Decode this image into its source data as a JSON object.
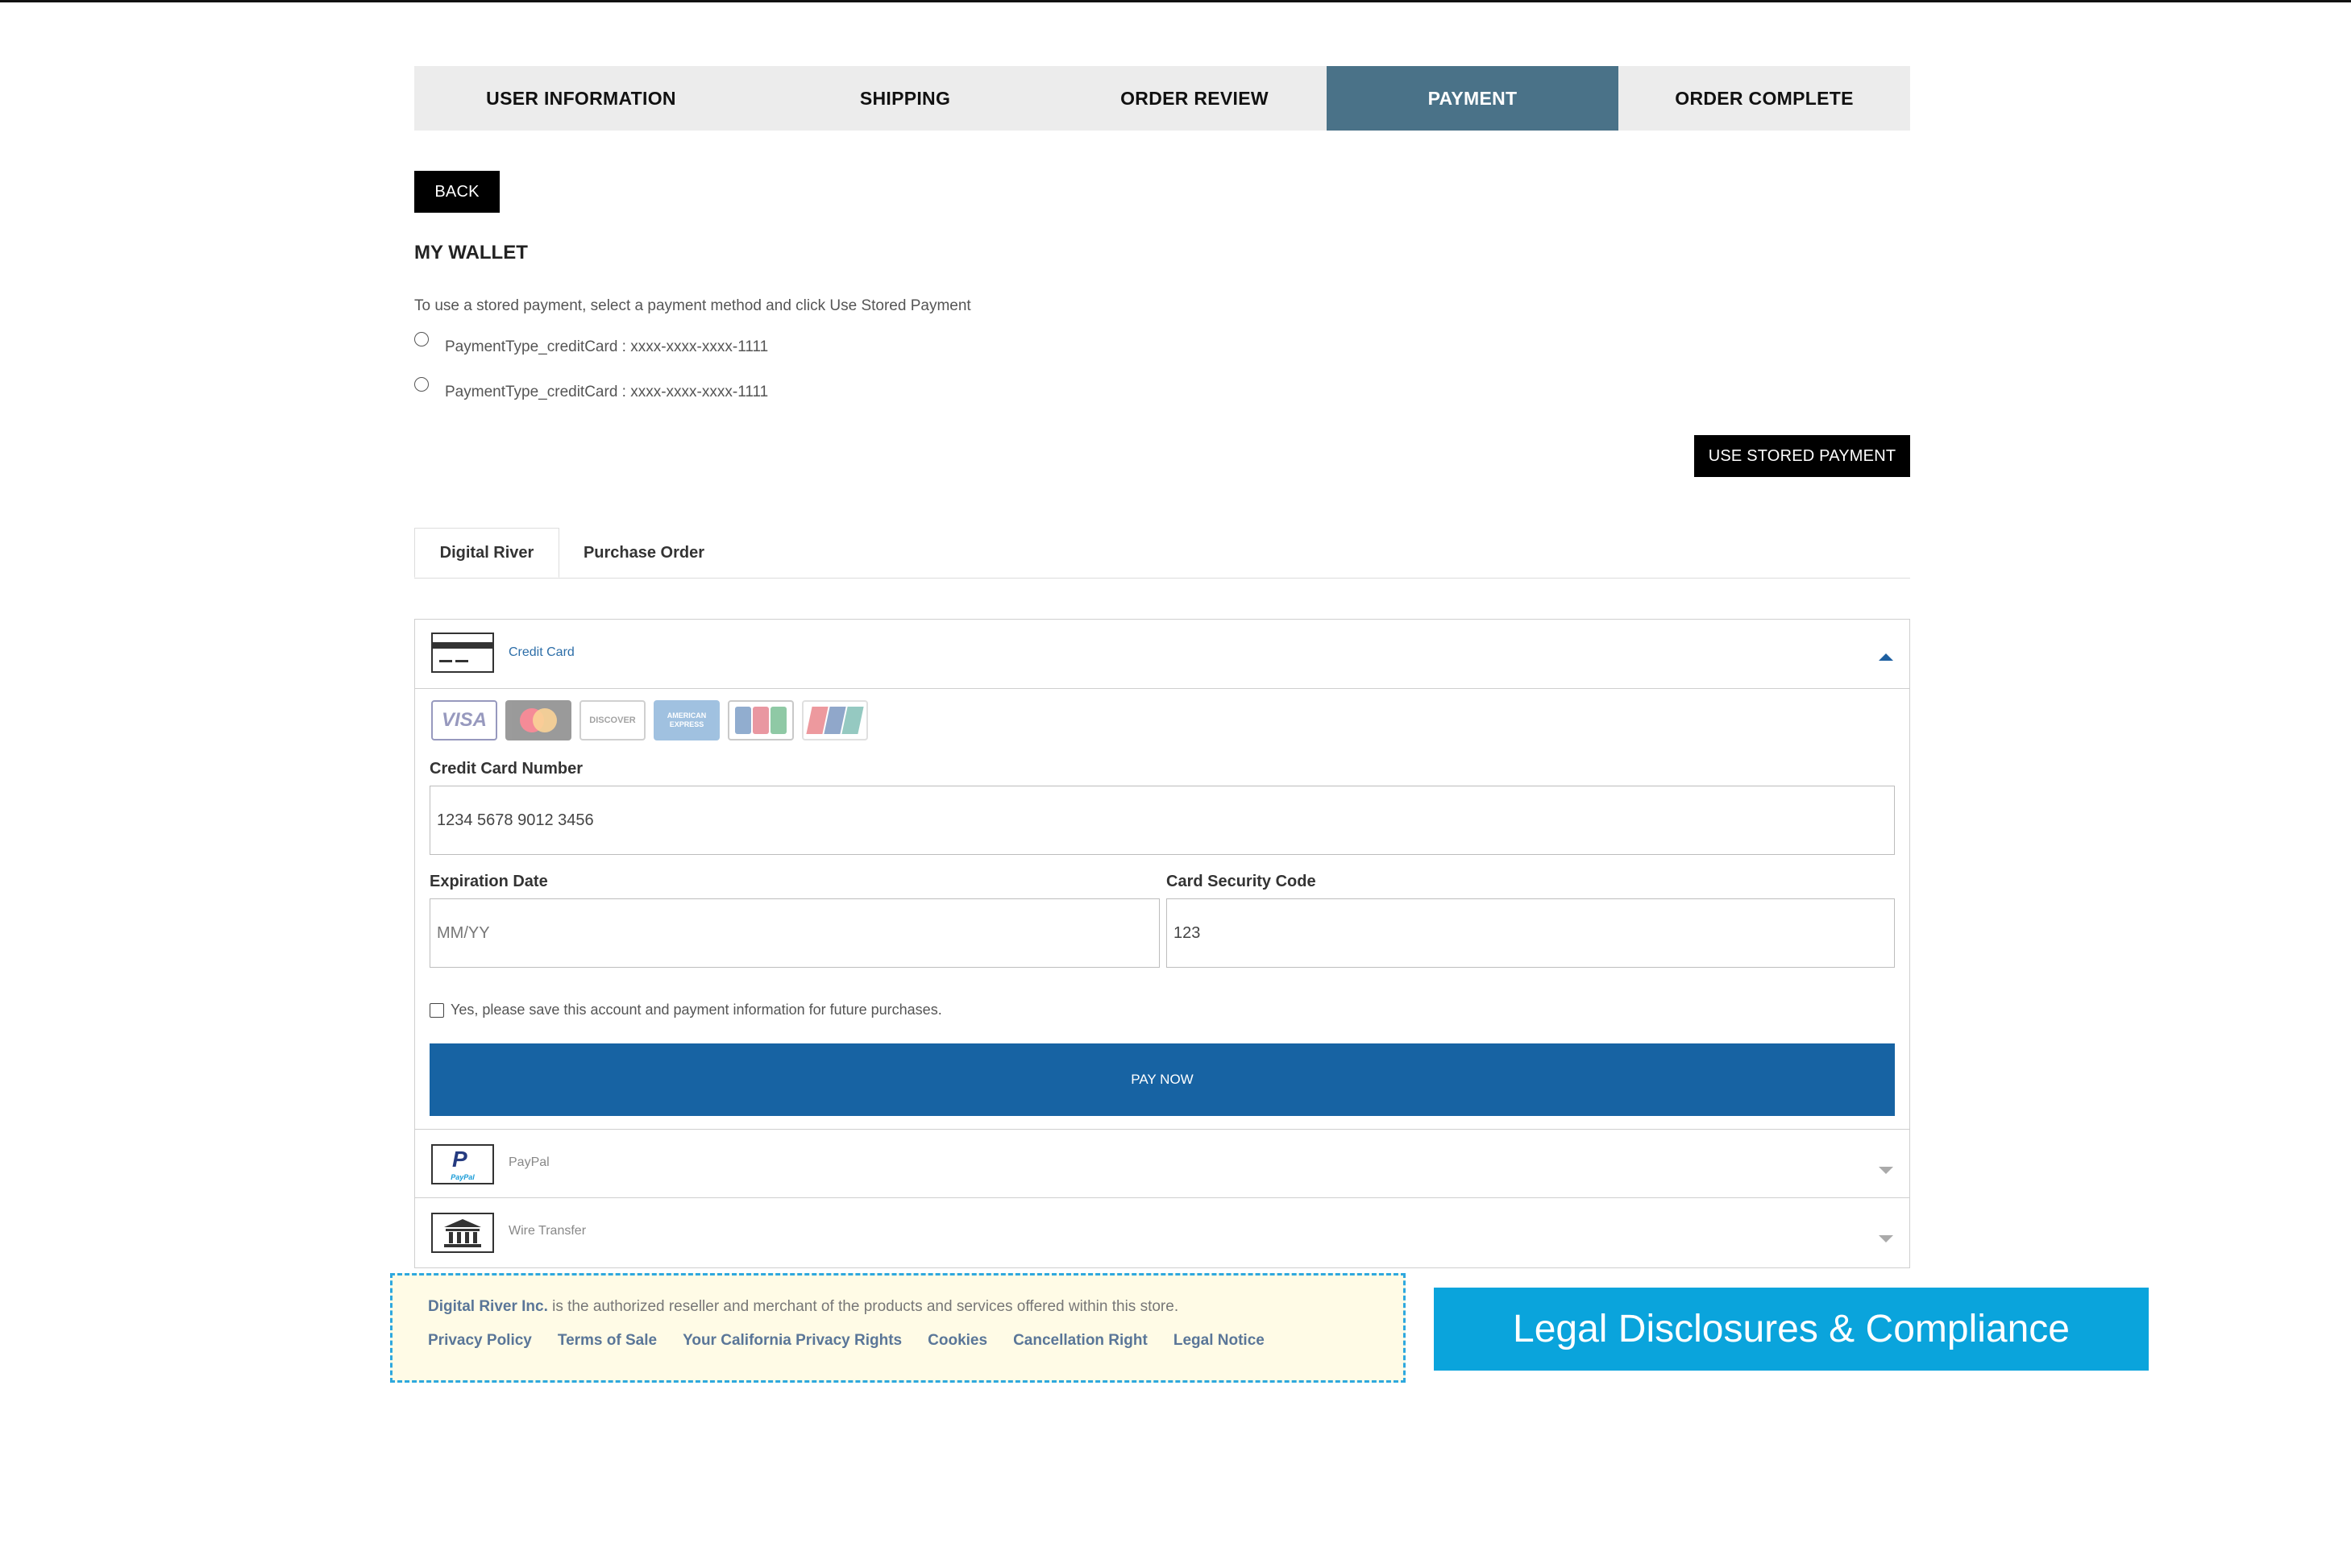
{
  "stepper": {
    "steps": [
      {
        "label": "USER INFORMATION"
      },
      {
        "label": "SHIPPING"
      },
      {
        "label": "ORDER REVIEW"
      },
      {
        "label": "PAYMENT"
      },
      {
        "label": "ORDER COMPLETE"
      }
    ],
    "active_step": "PAYMENT"
  },
  "back_button": {
    "label": "BACK"
  },
  "wallet": {
    "title": "MY WALLET",
    "hint": "To use a stored payment, select a payment method and click Use Stored Payment",
    "options": [
      {
        "label": "PaymentType_creditCard : xxxx-xxxx-xxxx-1111",
        "selected": false
      },
      {
        "label": "PaymentType_creditCard : xxxx-xxxx-xxxx-1111",
        "selected": false
      }
    ],
    "use_stored_label": "USE STORED PAYMENT"
  },
  "tabs": [
    {
      "label": "Digital River",
      "active": true
    },
    {
      "label": "Purchase Order",
      "active": false
    }
  ],
  "payment": {
    "credit_card": {
      "label": "Credit Card",
      "icon": "credit-card-icon",
      "expanded": true,
      "card_logos": [
        "VISA",
        "MC",
        "DISCOVER",
        "AMERICAN EXPRESS",
        "JCB",
        "UnionPay"
      ],
      "number_label": "Credit Card Number",
      "number_value": "1234 5678 9012 3456",
      "expiry_label": "Expiration Date",
      "expiry_placeholder": "MM/YY",
      "cvc_label": "Card Security Code",
      "cvc_value": "123",
      "save_label": "Yes, please save this account and payment information for future purchases.",
      "save_checked": false,
      "pay_label": "PAY NOW"
    },
    "paypal": {
      "label": "PayPal",
      "icon": "paypal-icon",
      "expanded": false
    },
    "wire": {
      "label": "Wire Transfer",
      "icon": "bank-icon",
      "expanded": false
    }
  },
  "legal": {
    "brand": "Digital River Inc.",
    "statement": " is the authorized reseller and merchant of the products and services offered within this store.",
    "links": [
      "Privacy Policy",
      "Terms of Sale",
      "Your California Privacy Rights",
      "Cookies",
      "Cancellation Right",
      "Legal Notice"
    ]
  },
  "callout": {
    "text": "Legal Disclosures & Compliance"
  },
  "colors": {
    "active_step": "#4a7288",
    "pay_button": "#1763a3",
    "callout": "#0aa4dc",
    "legal_border": "#2ea8de",
    "link": "#5a7698"
  }
}
